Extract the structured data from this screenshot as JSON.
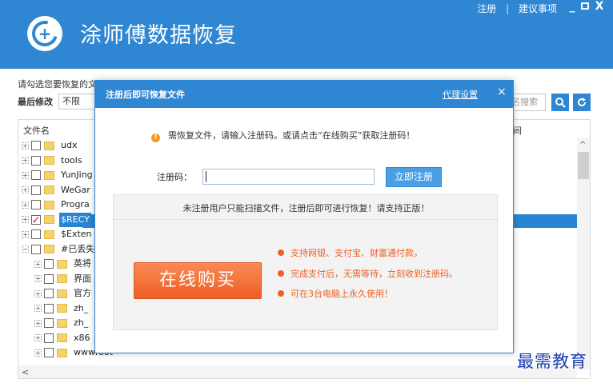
{
  "app": {
    "title": "涂师傅数据恢复",
    "links": {
      "register": "注册",
      "separator": "|",
      "feedback": "建议事项"
    },
    "window_controls": {
      "minimize": "_",
      "close": "X"
    }
  },
  "toolbar": {
    "hint": "请勾选您要恢复的文",
    "filter_label": "最后修改",
    "filter_value": "不限",
    "search_placeholder": "名搜索",
    "search_icon": "search-icon",
    "refresh_icon": "refresh-icon"
  },
  "tree": {
    "column_name": "文件名",
    "column_time": "间",
    "rows": [
      {
        "name": "udx",
        "checked": false
      },
      {
        "name": "tools",
        "checked": false
      },
      {
        "name": "YunJing",
        "checked": false
      },
      {
        "name": "WeGar",
        "checked": false
      },
      {
        "name": "Progra",
        "checked": false
      },
      {
        "name": "$RECY",
        "checked": true,
        "selected": true
      },
      {
        "name": "$Exten",
        "checked": false
      },
      {
        "name": "#已丢失",
        "checked": false
      },
      {
        "name": "英将",
        "checked": false
      },
      {
        "name": "界面",
        "checked": false
      },
      {
        "name": "官方",
        "checked": false
      },
      {
        "name": "zh_",
        "checked": false
      },
      {
        "name": "zh_",
        "checked": false
      },
      {
        "name": "x86",
        "checked": false
      },
      {
        "name": "wwwroot",
        "checked": false
      }
    ],
    "scroll_up": "^",
    "scroll_left": "<"
  },
  "dialog": {
    "title": "注册后即可恢复文件",
    "proxy_link": "代理设置",
    "close": "×",
    "notice": "需恢复文件，请输入注册码。或请点击“在线购买”获取注册码！",
    "reg_label": "注册码：",
    "reg_value": "",
    "reg_button": "立即注册",
    "promo_line": "未注册用户只能扫描文件，注册后即可进行恢复！请支持正版！",
    "buy_button": "在线购买",
    "features": [
      "支持网银、支付宝、财富通付款。",
      "完成支付后，无需等待，立刻收到注册码。",
      "可在3台电脑上永久使用！"
    ]
  },
  "watermark": "最需教育",
  "colors": {
    "primary": "#2f86d2",
    "accent": "#ee5f25",
    "selection": "#2a84d4"
  }
}
